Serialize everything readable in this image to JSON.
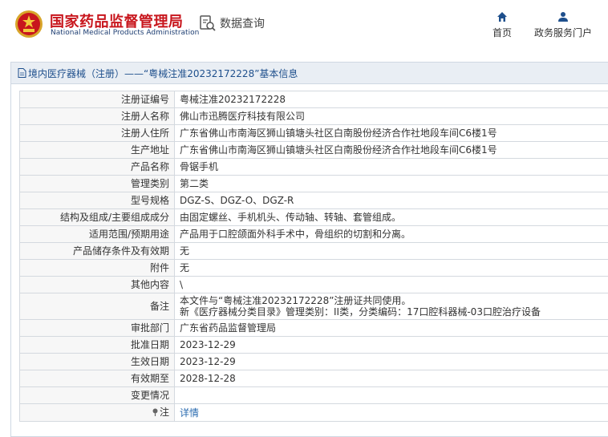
{
  "header": {
    "logo_cn": "国家药品监督管理局",
    "logo_en": "National Medical Products Administration",
    "query_label": "数据查询",
    "nav": {
      "home": "首页",
      "services": "政务服务门户"
    }
  },
  "panel": {
    "title": "境内医疗器械（注册）——“粤械注准20232172228”基本信息"
  },
  "rows": [
    {
      "label": "注册证编号",
      "value": "粤械注准20232172228"
    },
    {
      "label": "注册人名称",
      "value": "佛山市迅腾医疗科技有限公司"
    },
    {
      "label": "注册人住所",
      "value": "广东省佛山市南海区狮山镇塘头社区白南股份经济合作社地段车间C6楼1号"
    },
    {
      "label": "生产地址",
      "value": "广东省佛山市南海区狮山镇塘头社区白南股份经济合作社地段车间C6楼1号"
    },
    {
      "label": "产品名称",
      "value": "骨锯手机"
    },
    {
      "label": "管理类别",
      "value": "第二类"
    },
    {
      "label": "型号规格",
      "value": "DGZ-S、DGZ-O、DGZ-R"
    },
    {
      "label": "结构及组成/主要组成成分",
      "value": "由固定螺丝、手机机头、传动轴、转轴、套管组成。"
    },
    {
      "label": "适用范围/预期用途",
      "value": "产品用于口腔颌面外科手术中，骨组织的切割和分离。"
    },
    {
      "label": "产品储存条件及有效期",
      "value": "无"
    },
    {
      "label": "附件",
      "value": "无"
    },
    {
      "label": "其他内容",
      "value": "\\"
    },
    {
      "label": "备注",
      "value1": "本文件与“粤械注准20232172228”注册证共同使用。",
      "value2": "新《医疗器械分类目录》管理类别：II类，分类编码：17口腔科器械-03口腔治疗设备"
    },
    {
      "label": "审批部门",
      "value": "广东省药品监督管理局"
    },
    {
      "label": "批准日期",
      "value": "2023-12-29"
    },
    {
      "label": "生效日期",
      "value": "2023-12-29"
    },
    {
      "label": "有效期至",
      "value": "2028-12-28"
    },
    {
      "label": "变更情况",
      "value": ""
    },
    {
      "label": "注",
      "value": "详情"
    }
  ],
  "colors": {
    "brand_red": "#c8161d",
    "nav_blue": "#1e4f8c",
    "link_blue": "#2b6cb0"
  }
}
